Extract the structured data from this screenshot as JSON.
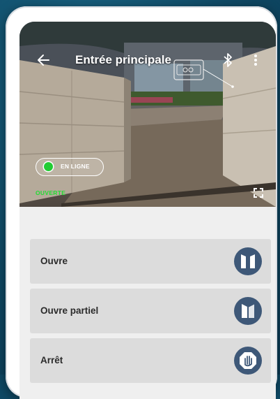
{
  "header": {
    "title": "Entrée principale",
    "back_icon": "arrow-left-icon",
    "bluetooth_icon": "bluetooth-icon",
    "menu_icon": "more-vertical-icon"
  },
  "camera": {
    "status_badge": "EN LIGNE",
    "status_color": "#22cc33",
    "gate_state": "OUVERTE",
    "gate_state_color": "#22dd33",
    "fullscreen_icon": "fullscreen-icon"
  },
  "commands": [
    {
      "label": "Ouvre",
      "icon": "gate-open-icon"
    },
    {
      "label": "Ouvre partiel",
      "icon": "gate-partial-icon"
    },
    {
      "label": "Arrêt",
      "icon": "stop-hand-icon"
    }
  ],
  "colors": {
    "background": "#0f4a66",
    "button_bg": "#dcdcdc",
    "icon_circle": "#3e5878"
  }
}
